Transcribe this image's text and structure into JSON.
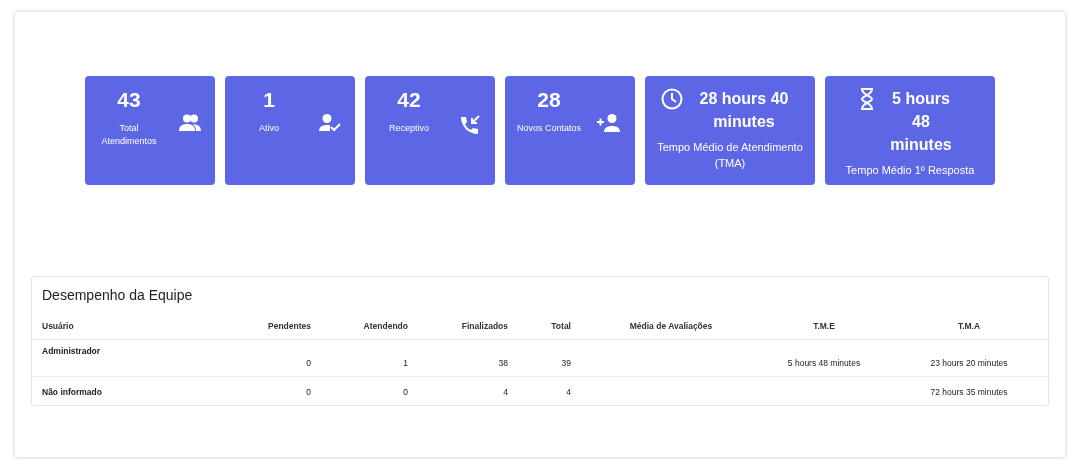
{
  "cards": [
    {
      "kind": "count",
      "value": "43",
      "label": "Total Atendimentos"
    },
    {
      "kind": "count",
      "value": "1",
      "label": "Ativo"
    },
    {
      "kind": "count",
      "value": "42",
      "label": "Receptivo"
    },
    {
      "kind": "count",
      "value": "28",
      "label": "Novos Contatos"
    },
    {
      "kind": "time",
      "value": "28 hours 40 minutes",
      "label": "Tempo Médio de Atendimento (TMA)"
    },
    {
      "kind": "time",
      "value": "5 hours 48 minutes",
      "label": "Tempo Médio 1º Resposta"
    }
  ],
  "team_table": {
    "title": "Desempenho da Equipe",
    "columns": [
      "Usuário",
      "Pendentes",
      "Atendendo",
      "Finalizados",
      "Total",
      "Média de Avaliações",
      "T.M.E",
      "T.M.A"
    ],
    "rows": [
      {
        "user": "Administrador",
        "pending": "0",
        "attending": "1",
        "finished": "38",
        "total": "39",
        "tme": "5 hours 48 minutes",
        "tma": "23 hours 20 minutes"
      },
      {
        "user": "Não informado",
        "pending": "0",
        "attending": "0",
        "finished": "4",
        "total": "4",
        "tma": "72 hours 35 minutes"
      }
    ]
  }
}
